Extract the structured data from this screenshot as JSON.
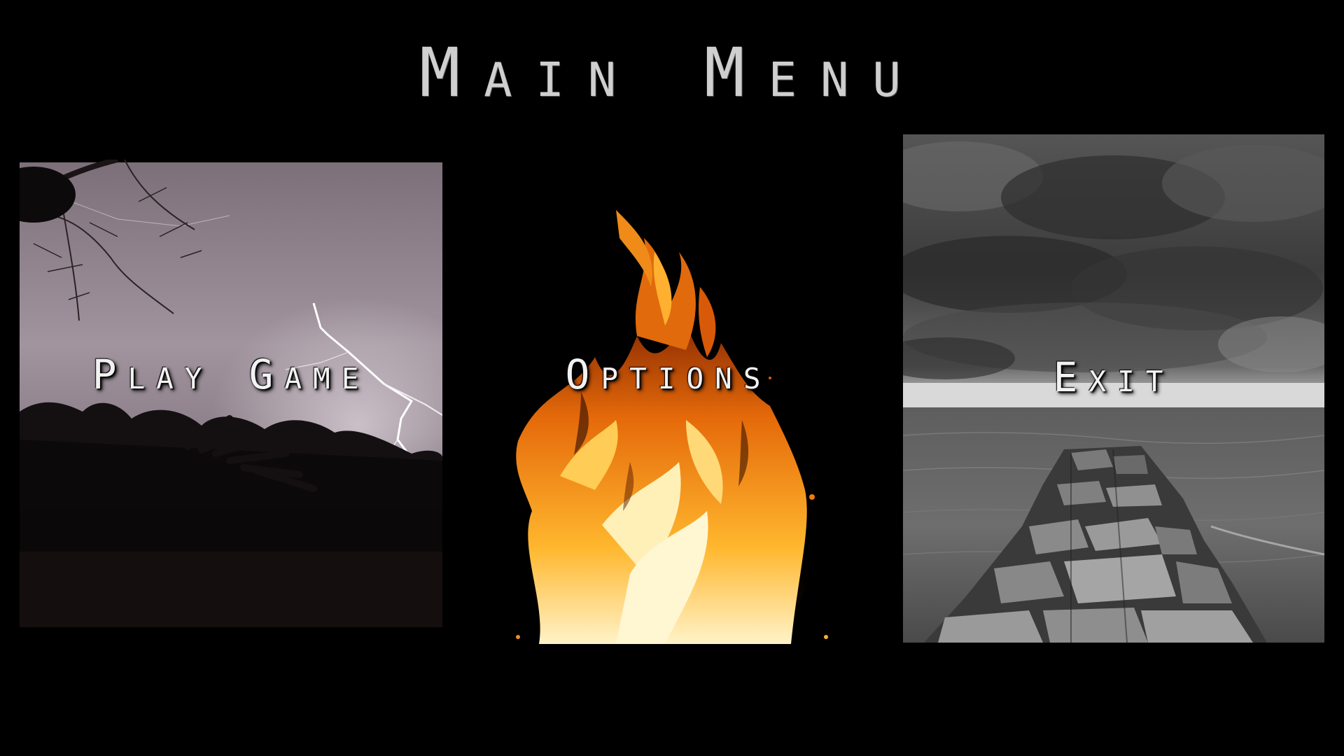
{
  "menu": {
    "title": "Main Menu",
    "items": [
      {
        "label": "Play Game",
        "image": "lightning-storm-night"
      },
      {
        "label": "Options",
        "image": "campfire-flames"
      },
      {
        "label": "Exit",
        "image": "stormy-sea-jetty"
      }
    ]
  },
  "colors": {
    "background": "#000000",
    "title_text": "#cfcfcf",
    "label_text": "#f2f2f2",
    "lightning_sky": "#8a7f88",
    "flame": "#f7a21a",
    "storm_gray": "#6b6b6b"
  }
}
